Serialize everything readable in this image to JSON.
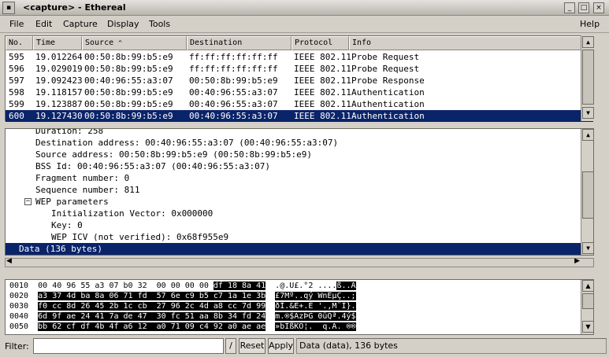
{
  "window": {
    "title": "<capture> - Ethereal"
  },
  "menu": [
    {
      "label": "File"
    },
    {
      "label": "Edit"
    },
    {
      "label": "Capture"
    },
    {
      "label": "Display"
    },
    {
      "label": "Tools"
    },
    {
      "label": "Help"
    }
  ],
  "packet_list": {
    "columns": [
      "No.",
      "Time",
      "Source",
      "Destination",
      "Protocol",
      "Info"
    ],
    "sort_indicator": "^",
    "rows": [
      {
        "no": "595",
        "time": "19.012264",
        "source": "00:50:8b:99:b5:e9",
        "destination": "ff:ff:ff:ff:ff:ff",
        "protocol": "IEEE 802.11",
        "info": "Probe Request"
      },
      {
        "no": "596",
        "time": "19.029019",
        "source": "00:50:8b:99:b5:e9",
        "destination": "ff:ff:ff:ff:ff:ff",
        "protocol": "IEEE 802.11",
        "info": "Probe Request"
      },
      {
        "no": "597",
        "time": "19.092423",
        "source": "00:40:96:55:a3:07",
        "destination": "00:50:8b:99:b5:e9",
        "protocol": "IEEE 802.11",
        "info": "Probe Response"
      },
      {
        "no": "598",
        "time": "19.118157",
        "source": "00:50:8b:99:b5:e9",
        "destination": "00:40:96:55:a3:07",
        "protocol": "IEEE 802.11",
        "info": "Authentication"
      },
      {
        "no": "599",
        "time": "19.123887",
        "source": "00:50:8b:99:b5:e9",
        "destination": "00:40:96:55:a3:07",
        "protocol": "IEEE 802.11",
        "info": "Authentication"
      },
      {
        "no": "600",
        "time": "19.127430",
        "source": "00:50:8b:99:b5:e9",
        "destination": "00:40:96:55:a3:07",
        "protocol": "IEEE 802.11",
        "info": "Authentication"
      }
    ],
    "selected_row": 5
  },
  "details": {
    "lines": [
      "Duration: 258",
      "Destination address: 00:40:96:55:a3:07 (00:40:96:55:a3:07)",
      "Source address: 00:50:8b:99:b5:e9 (00:50:8b:99:b5:e9)",
      "BSS Id: 00:40:96:55:a3:07 (00:40:96:55:a3:07)",
      "Fragment number: 0",
      "Sequence number: 811",
      "WEP parameters",
      "Initialization Vector: 0x000000",
      "Key: 0",
      "WEP ICV (not verified): 0x68f955e9",
      "Data (136 bytes)"
    ]
  },
  "hex": {
    "lines": [
      {
        "offset": "0010",
        "plain": "00 40 96 55 a3 07 b0 32  00 00 00 00 ",
        "hl": "df 18 8a 41",
        "ascii_plain": "  .@.U£.°2 ....",
        "ascii_hl": "ß..A"
      },
      {
        "offset": "0020",
        "plain": "",
        "hl": "a3 37 4d ba 8a 06 71 fd  57 6e c9 b5 c7 1a 1e 3b",
        "ascii_plain": "  ",
        "ascii_hl": "£7Mº..qý WnÉµÇ..;"
      },
      {
        "offset": "0030",
        "plain": "",
        "hl": "f0 cc 8d 26 45 2b 1c cb  27 96 2c 4d a8 cc 7d 99",
        "ascii_plain": "  ",
        "ascii_hl": "ðÌ.&E+.Ë '.,M¨Ì}."
      },
      {
        "offset": "0040",
        "plain": "",
        "hl": "6d 9f ae 24 41 7a de 47  30 fc 51 aa 8b 34 fd 24",
        "ascii_plain": "  ",
        "ascii_hl": "m.®$AzÞG 0üQª.4ý$"
      },
      {
        "offset": "0050",
        "plain": "",
        "hl": "bb 62 cf df 4b 4f a6 12  a0 71 09 c4 92 a0 ae ae",
        "ascii_plain": "  ",
        "ascii_hl": "»bÏßKO¦.  q.Ä. ®®"
      }
    ]
  },
  "filter": {
    "label": "Filter:",
    "value": "",
    "reset_label": "Reset",
    "apply_label": "Apply",
    "status": "Data (data), 136 bytes"
  },
  "colors": {
    "selection": "#0a246a",
    "window_bg": "#d4d0c8"
  }
}
